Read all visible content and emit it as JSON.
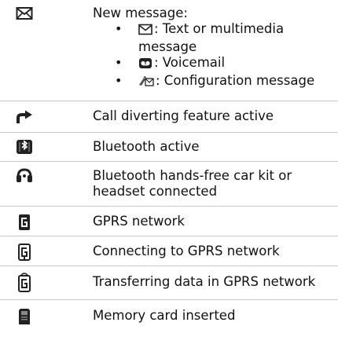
{
  "rows": [
    {
      "icon": "envelope-icon",
      "label": "New message:",
      "sub_items": [
        {
          "icon": "envelope-icon",
          "label": ": Text or multimedia",
          "label_cont": "message"
        },
        {
          "icon": "voicemail-tape-icon",
          "label": ": Voicemail"
        },
        {
          "icon": "configuration-message-icon",
          "label": ": Configuration message"
        }
      ]
    },
    {
      "icon": "call-divert-arrow-icon",
      "label": "Call diverting feature active"
    },
    {
      "icon": "bluetooth-icon",
      "label": "Bluetooth active"
    },
    {
      "icon": "headset-icon",
      "label": "Bluetooth hands-free car kit or",
      "label_cont": "headset connected"
    },
    {
      "icon": "gprs-network-icon",
      "label": "GPRS network"
    },
    {
      "icon": "gprs-connecting-icon",
      "label": "Connecting to GPRS network"
    },
    {
      "icon": "gprs-transferring-icon",
      "label": "Transferring data in GPRS network"
    },
    {
      "icon": "memory-card-icon",
      "label": "Memory card inserted"
    }
  ]
}
